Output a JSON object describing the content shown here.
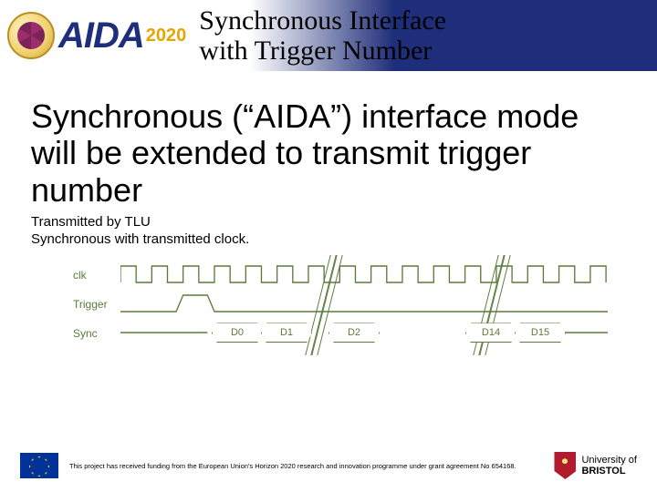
{
  "logo": {
    "name": "AIDA",
    "year": "2020"
  },
  "title_line1": "Synchronous Interface",
  "title_line2": "with Trigger Number",
  "headline": "Synchronous (“AIDA”) interface mode will be extended to transmit trigger number",
  "sub1": "Transmitted by TLU",
  "sub2": "Synchronous with transmitted clock.",
  "signals": {
    "clk": "clk",
    "trigger": "Trigger",
    "sync": "Sync",
    "bits": [
      "D0",
      "D1",
      "D2",
      "D14",
      "D15"
    ]
  },
  "footer": "This project has received funding from the European Union's Horizon 2020 research and innovation programme under grant agreement No 654168.",
  "bristol": {
    "l1": "University of",
    "l2": "BRISTOL"
  }
}
